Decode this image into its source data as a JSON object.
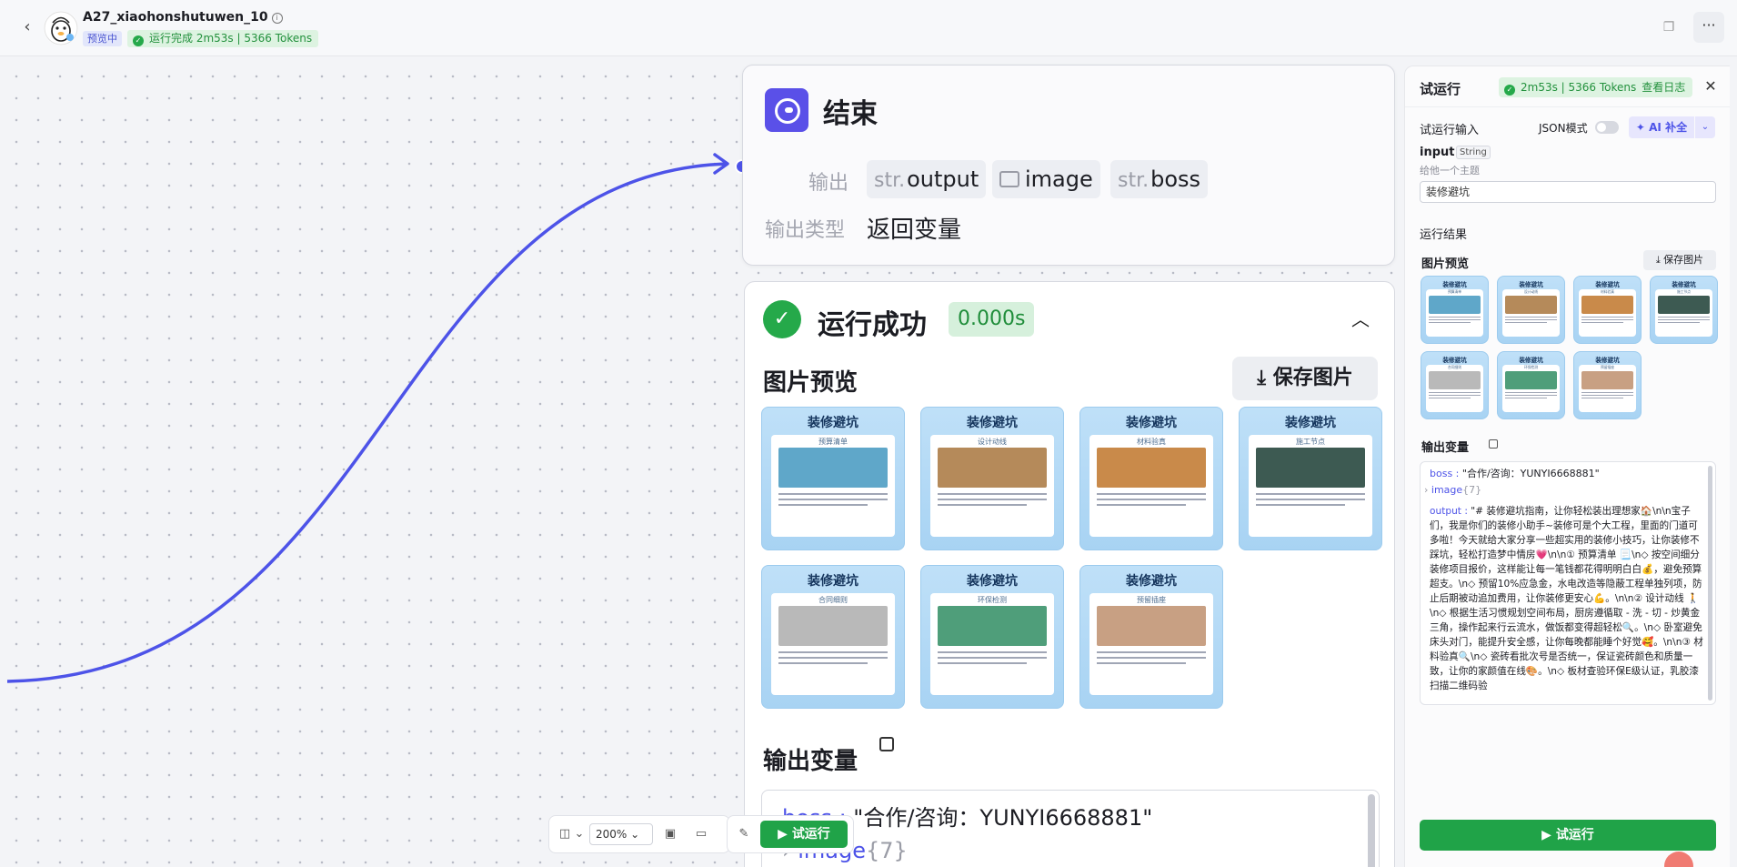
{
  "header": {
    "back_icon": "chevron-left-icon",
    "app_name": "A27_xiaohonshutuwen_10",
    "preview_badge": "预览中",
    "run_status": "运行完成 2m53s | 5366 Tokens"
  },
  "end_node": {
    "title": "结束",
    "output_label": "输出",
    "outputs": [
      {
        "prefix": "str.",
        "name": "output"
      },
      {
        "prefix": "img",
        "name": "image"
      },
      {
        "prefix": "str.",
        "name": "boss"
      }
    ],
    "output_type_label": "输出类型",
    "output_type_value": "返回变量"
  },
  "result": {
    "title": "运行成功",
    "time": "0.000s",
    "image_preview_title": "图片预览",
    "save_images": "保存图片",
    "output_vars_title": "输出变量",
    "boss_key": "boss",
    "boss_value": "\"合作/咨询：YUNYI6668881\"",
    "image_key": "image",
    "image_count": "{7}",
    "images": [
      {
        "head": "装修避坑",
        "sub": "预算清单",
        "color": "#5fa7c9"
      },
      {
        "head": "装修避坑",
        "sub": "设计动线",
        "color": "#b58a5a"
      },
      {
        "head": "装修避坑",
        "sub": "材料验真",
        "color": "#c98a4a"
      },
      {
        "head": "装修避坑",
        "sub": "施工节点",
        "color": "#3d5a52"
      },
      {
        "head": "装修避坑",
        "sub": "合同细则",
        "color": "#b9b9b9"
      },
      {
        "head": "装修避坑",
        "sub": "环保检测",
        "color": "#4f9e7a"
      },
      {
        "head": "装修避坑",
        "sub": "预留插座",
        "color": "#c8a083"
      }
    ]
  },
  "toolbar": {
    "zoom": "200%",
    "run_label": "试运行"
  },
  "panel": {
    "title": "试运行",
    "status": "2m53s | 5366 Tokens",
    "view_log": "查看日志",
    "input_section": "试运行输入",
    "json_mode": "JSON模式",
    "ai_fill": "AI 补全",
    "input_name": "input",
    "input_type": "String",
    "input_desc": "给他一个主题",
    "input_value": "装修避坑",
    "result_section": "运行结果",
    "image_preview": "图片预览",
    "save_images": "保存图片",
    "output_vars": "输出变量",
    "boss_key": "boss",
    "boss_value": "\"合作/咨询：YUNYI6668881\"",
    "image_key": "image",
    "image_count": "{7}",
    "output_key": "output",
    "output_value": "\"# 装修避坑指南，让你轻松装出理想家🏠\\n\\n宝子们，我是你们的装修小助手~装修可是个大工程，里面的门道可多啦！今天就给大家分享一些超实用的装修小技巧，让你装修不踩坑，轻松打造梦中情房💗\\n\\n① 预算清单 📃\\n◇ 按空间细分装修项目报价，这样能让每一笔钱都花得明明白白💰，避免预算超支。\\n◇ 预留10%应急金，水电改造等隐蔽工程单独列项，防止后期被动追加费用，让你装修更安心💪。\\n\\n② 设计动线 🚶\\n◇ 根据生活习惯规划空间布局，厨房遵循取 - 洗 - 切 - 炒黄金三角，操作起来行云流水，做饭都变得超轻松🔍。\\n◇ 卧室避免床头对门，能提升安全感，让你每晚都能睡个好觉🥰。\\n\\n③ 材料验真🔍\\n◇ 瓷砖看批次号是否统一，保证瓷砖颜色和质量一致，让你的家颜值在线🎨。\\n◇ 板材查验环保E级认证，乳胶漆扫描二维码验",
    "run_label": "试运行"
  }
}
